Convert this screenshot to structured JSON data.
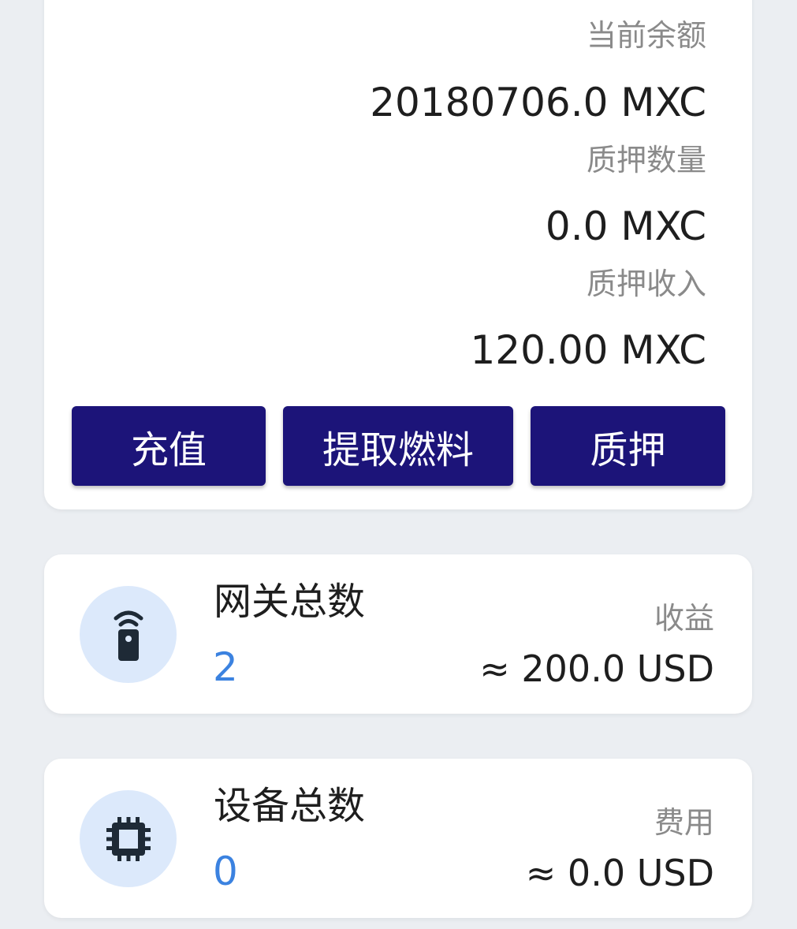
{
  "balance": {
    "current_balance_label": "当前余额",
    "current_balance_value": "20180706.0 MXC",
    "staked_amount_label": "质押数量",
    "staked_amount_value": "0.0 MXC",
    "staking_income_label": "质押收入",
    "staking_income_value": "120.00 MXC"
  },
  "actions": {
    "topup_label": "充值",
    "withdraw_label": "提取燃料",
    "stake_label": "质押"
  },
  "gateways": {
    "title": "网关总数",
    "count": "2",
    "right_label": "收益",
    "right_value": "≈ 200.0 USD",
    "icon": "gateway-remote-icon"
  },
  "devices": {
    "title": "设备总数",
    "count": "0",
    "right_label": "费用",
    "right_value": "≈ 0.0 USD",
    "icon": "chip-icon"
  },
  "colors": {
    "background": "#ebeef2",
    "button": "#1c1479",
    "count": "#3b82e0",
    "icon_circle": "#dce9fb",
    "icon": "#1e2a36"
  }
}
